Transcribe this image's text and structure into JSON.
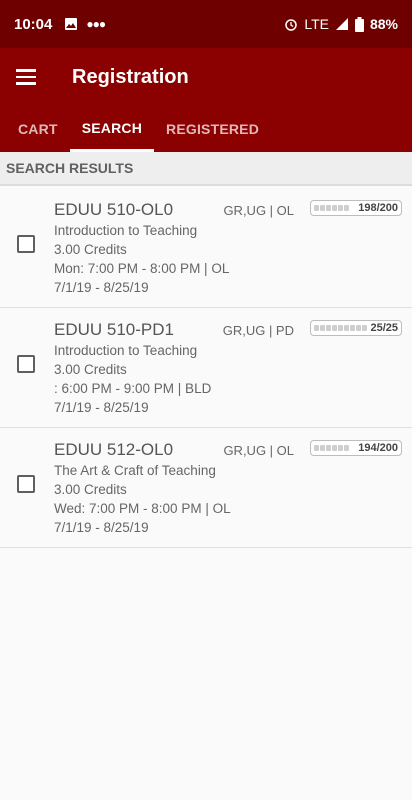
{
  "status_bar": {
    "time": "10:04",
    "network": "LTE",
    "battery": "88%"
  },
  "app_bar": {
    "title": "Registration",
    "tabs": [
      {
        "label": "CART",
        "active": false
      },
      {
        "label": "SEARCH",
        "active": true
      },
      {
        "label": "REGISTERED",
        "active": false
      }
    ]
  },
  "section": {
    "header": "SEARCH RESULTS"
  },
  "results": [
    {
      "code": "EDUU 510-OL0",
      "level": "GR,UG | OL",
      "capacity": "198/200",
      "title": "Introduction to Teaching",
      "credits": "3.00 Credits",
      "schedule": "Mon: 7:00 PM - 8:00 PM | OL",
      "dates": "7/1/19 - 8/25/19"
    },
    {
      "code": "EDUU 510-PD1",
      "level": "GR,UG | PD",
      "capacity": "25/25",
      "title": "Introduction to Teaching",
      "credits": "3.00 Credits",
      "schedule": ": 6:00 PM - 9:00 PM | BLD",
      "dates": "7/1/19 - 8/25/19"
    },
    {
      "code": "EDUU 512-OL0",
      "level": "GR,UG | OL",
      "capacity": "194/200",
      "title": "The Art & Craft of Teaching",
      "credits": "3.00 Credits",
      "schedule": "Wed: 7:00 PM - 8:00 PM | OL",
      "dates": "7/1/19 - 8/25/19"
    }
  ],
  "colors": {
    "status_bar": "#6f0000",
    "app_bar": "#8b0000",
    "background": "#fafafa"
  }
}
